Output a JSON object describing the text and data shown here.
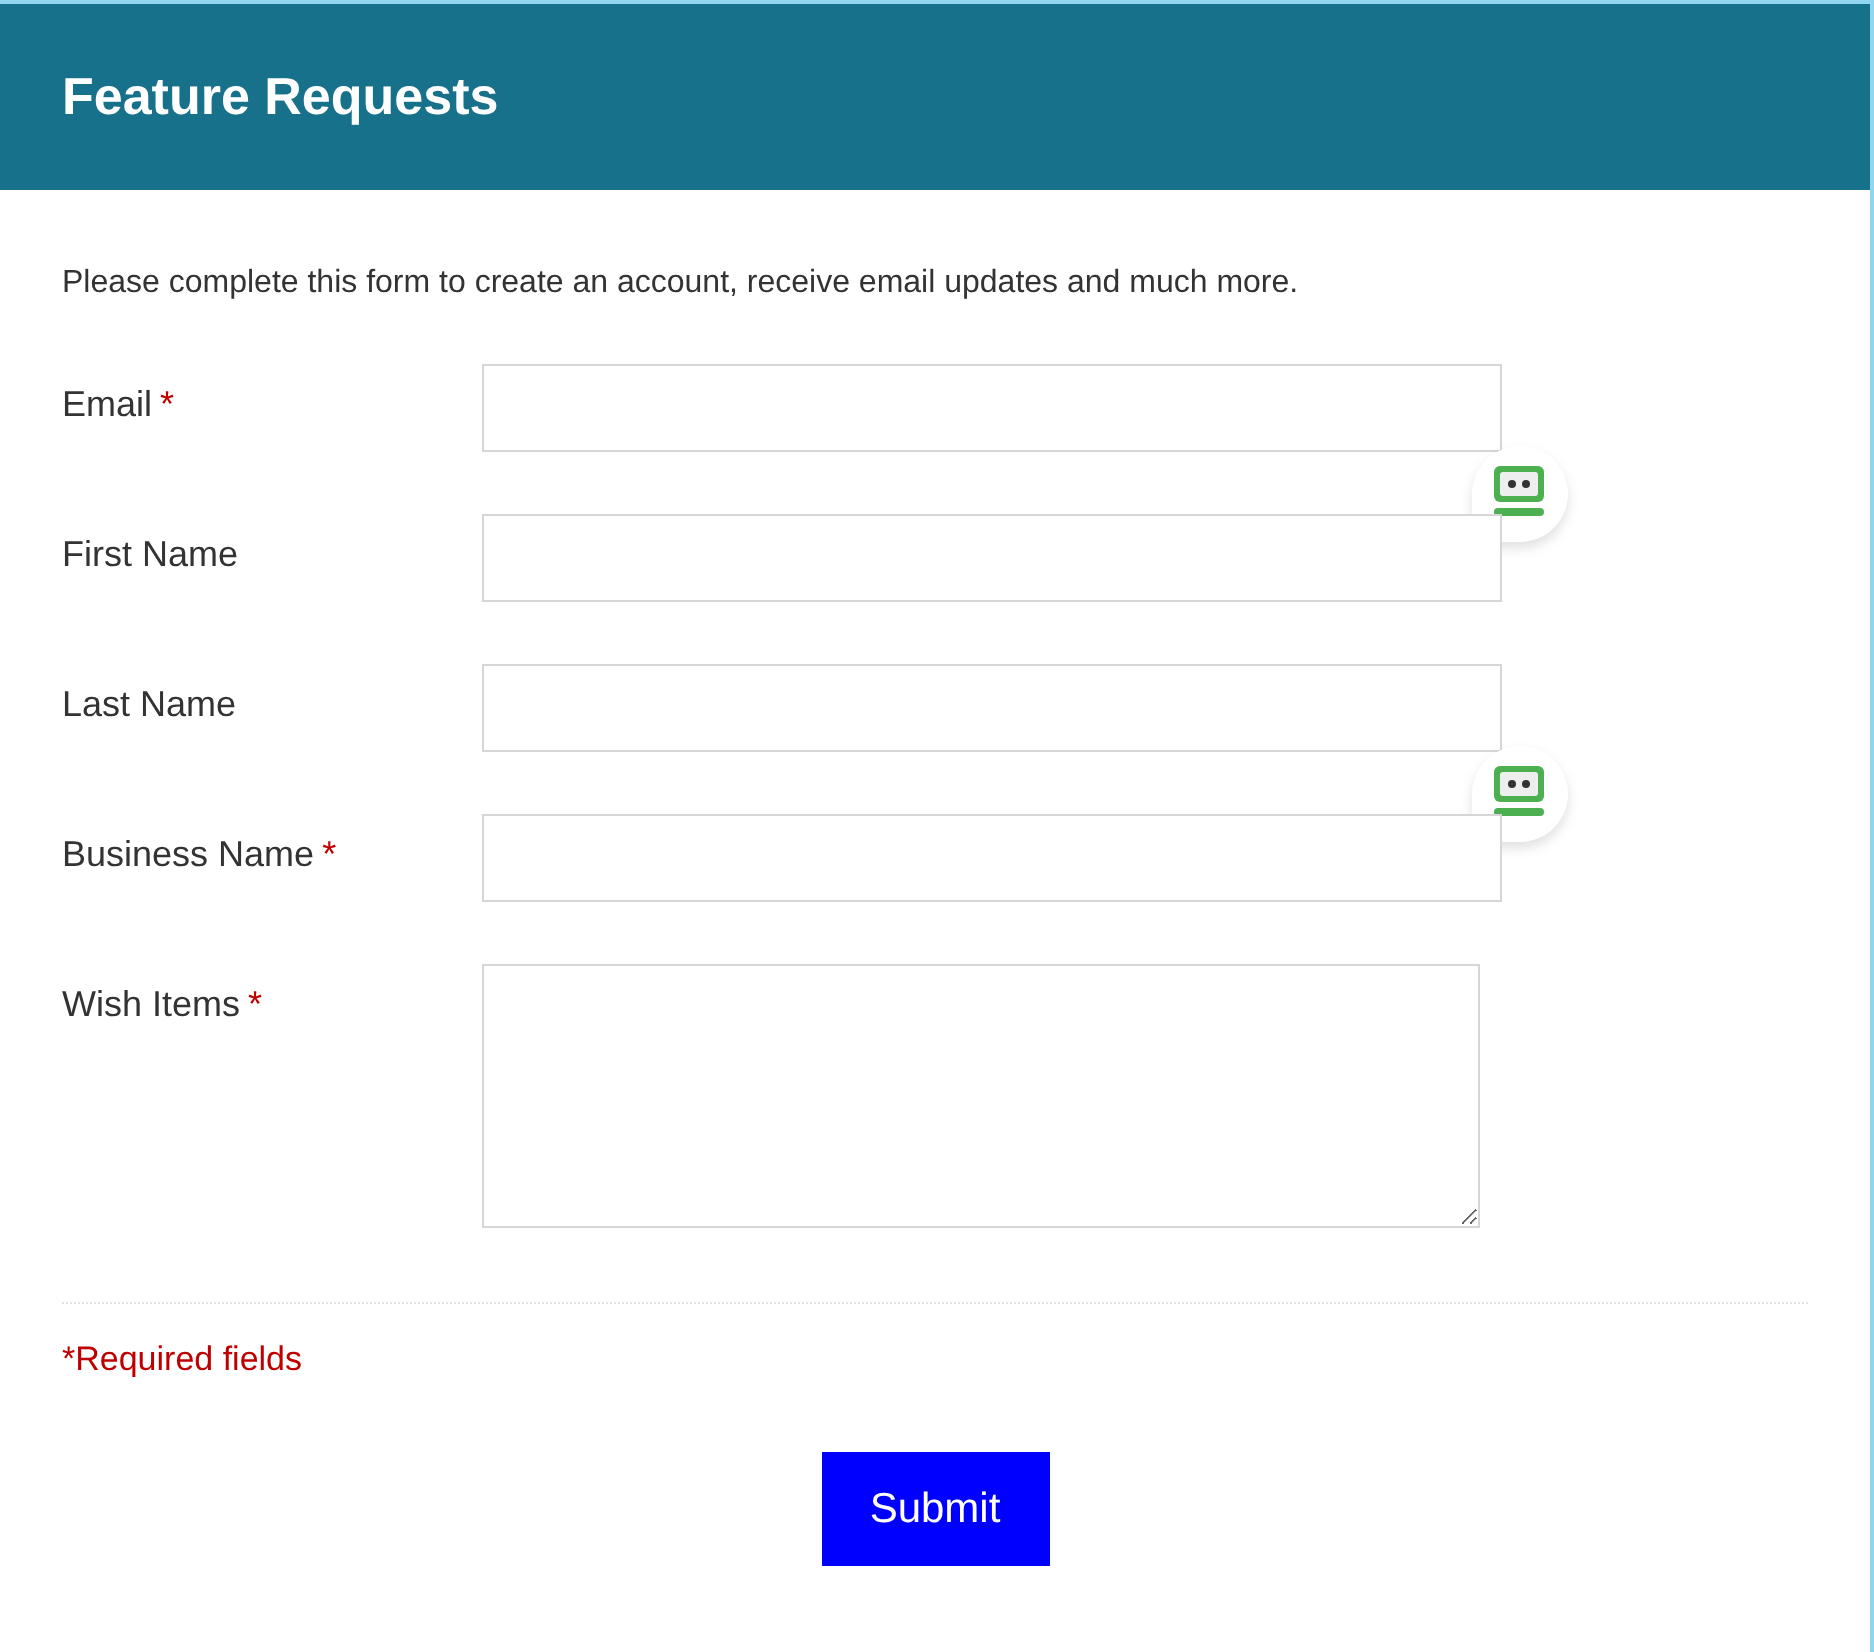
{
  "header": {
    "title": "Feature Requests"
  },
  "intro": "Please complete this form to create an account, receive email updates and much more.",
  "fields": [
    {
      "kind": "input",
      "label": "Email",
      "required_mark": "*",
      "badge": true
    },
    {
      "kind": "input",
      "label": "First Name",
      "badge": false
    },
    {
      "kind": "input",
      "label": "Last Name",
      "badge": true
    },
    {
      "kind": "input",
      "label": "Business Name",
      "required_mark": "*",
      "badge": false
    },
    {
      "kind": "textarea",
      "label": "Wish Items",
      "required_mark": "*",
      "badge": false
    }
  ],
  "required_note": "*Required fields",
  "submit": "Submit"
}
